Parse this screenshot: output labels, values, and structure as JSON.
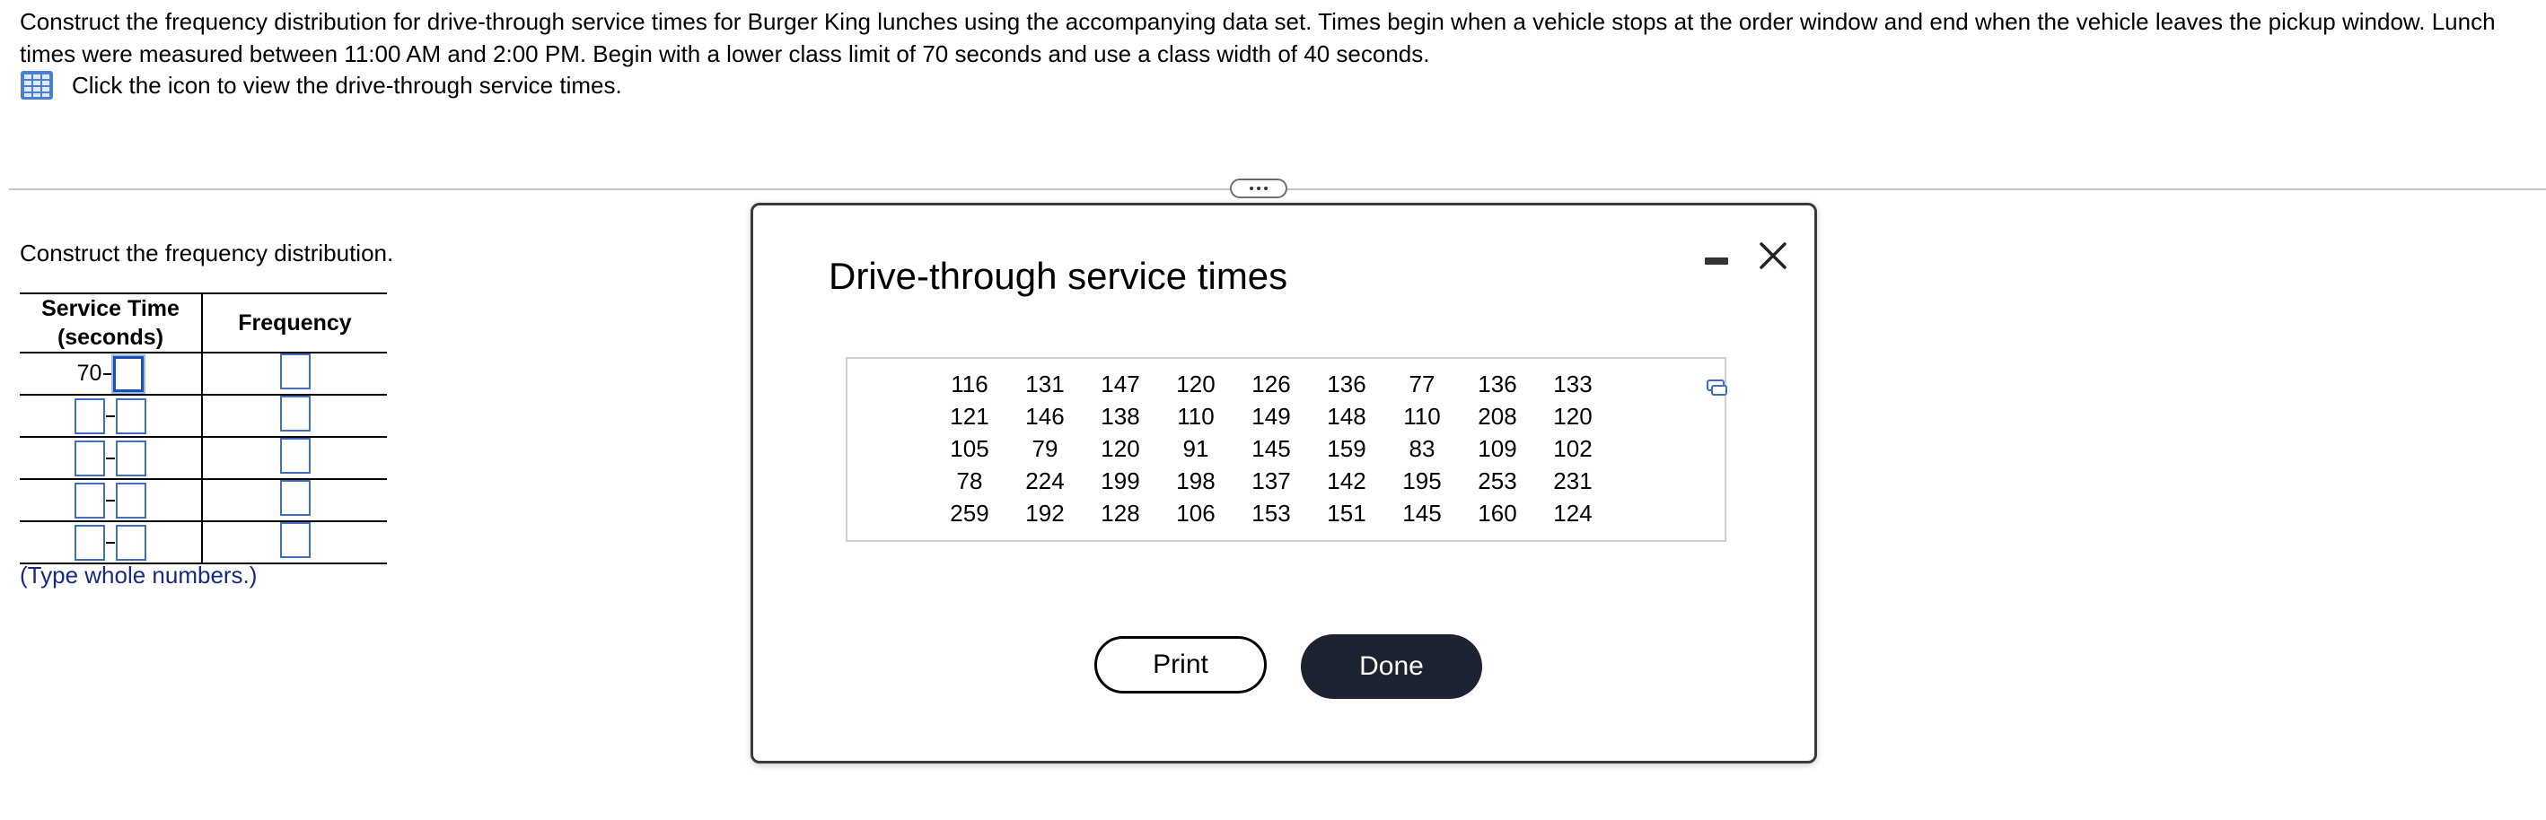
{
  "question": {
    "line1": "Construct the frequency distribution for drive-through service times for Burger King lunches using the accompanying data set. Times begin when a vehicle stops at the order window and end when the vehicle leaves the pickup window. Lunch",
    "line2": "times were measured between 11:00 AM and 2:00 PM. Begin with a lower class limit of 70 seconds and use a class width of 40 seconds.",
    "data_link_text": "Click the icon to view the drive-through service times."
  },
  "answer_section": {
    "instruction": "Construct the frequency distribution.",
    "table": {
      "header_service_line1": "Service Time",
      "header_service_line2": "(seconds)",
      "header_frequency": "Frequency",
      "first_lower_limit": "70"
    },
    "hint": "(Type whole numbers.)"
  },
  "modal": {
    "title": "Drive-through service times",
    "data": [
      [
        "116",
        "131",
        "147",
        "120",
        "126",
        "136",
        "77",
        "136",
        "133"
      ],
      [
        "121",
        "146",
        "138",
        "110",
        "149",
        "148",
        "110",
        "208",
        "120"
      ],
      [
        "105",
        "79",
        "120",
        "91",
        "145",
        "159",
        "83",
        "109",
        "102"
      ],
      [
        "78",
        "224",
        "199",
        "198",
        "137",
        "142",
        "195",
        "253",
        "231"
      ],
      [
        "259",
        "192",
        "128",
        "106",
        "153",
        "151",
        "145",
        "160",
        "124"
      ]
    ],
    "print_label": "Print",
    "done_label": "Done"
  },
  "colors": {
    "input_border": "#3f6ec4",
    "hint_text": "#162a85",
    "done_button_bg": "#1b2230",
    "icon_blue": "#4a7fd6"
  },
  "icons": {
    "data_table": "table-grid-icon",
    "divider": "more-dots-icon",
    "minimize": "minimize-icon",
    "close": "close-icon",
    "copy": "copy-icon"
  }
}
